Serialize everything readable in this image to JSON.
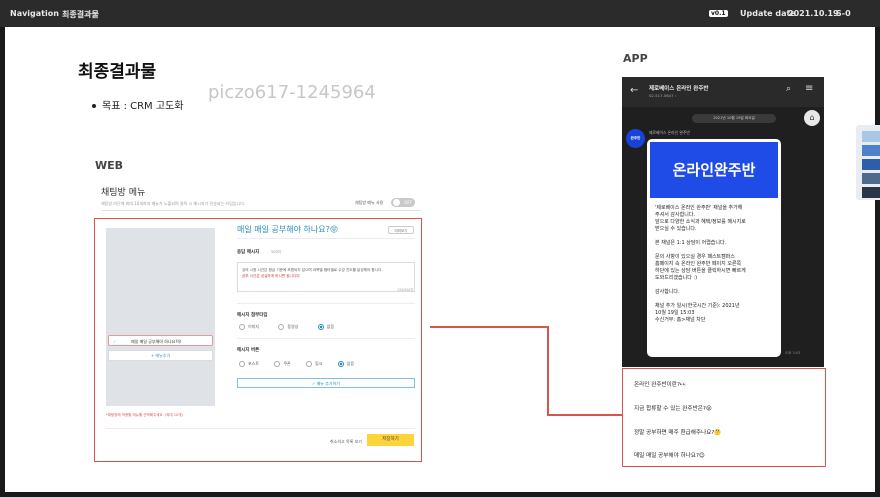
{
  "topbar": {
    "nav": "Navigation",
    "page": "최종결과물",
    "version": "v0.1",
    "update_label": "Update date",
    "update_date": "2021.10.19",
    "slide_no": "S-0"
  },
  "slide": {
    "title": "최종결과물",
    "goal": "목표 : CRM 고도화",
    "watermark": "piczo617-1245964",
    "web_label": "WEB",
    "app_label": "APP"
  },
  "web": {
    "header_title": "채팅방 메뉴",
    "header_desc": "채팅방 하단에 최대 10개까지 메뉴가 노출되며 클릭 시 메시지가 전송되는 타입입니다.",
    "toggle_label": "채팅방 메뉴 사용",
    "toggle_state": "OFF",
    "chip_text": "매일 매일 공부해야 하나요?😝",
    "add_menu": "+ 메뉴추가",
    "note": "*채팅방에 적용할 메뉴를 선택해주세요. (최대 10개)",
    "form_title": "매일 매일 공부해야 하나요?😝",
    "preview_button": "미리보기",
    "answer_label": "응답 메시지",
    "answer_sub": "500자",
    "answer_text_1": "강의 시청 시간은 환급 기준에 포함되지 않으며 과목별 챕터별로 수강 진도를 달성해야 합니다.",
    "answer_text_2": "공부 시간은 성실하게 하시면 됩니다😊",
    "counter": "134/500자",
    "attach_label": "메시지 첨부타입",
    "attach_options": [
      "이미지",
      "동영상",
      "없음"
    ],
    "button_label": "메시지 버튼",
    "button_options": [
      "포스트",
      "쿠폰",
      "링크",
      "없음"
    ],
    "add_message_btn": "✓ 메뉴 추가하기",
    "cancel": "취소하고 목록 보기",
    "save": "저장하기"
  },
  "app": {
    "channel_name": "제로베이스 온라인 완주반",
    "channel_sub": "02-517-0647 ›",
    "date_pill": "2021년 10월 19일 화요일",
    "sender": "제로베이스 온라인 완주반",
    "avatar_text": "완주반",
    "banner": "온라인완주반",
    "body_lines": [
      "'제로베이스 온라인 완주반' 채널을 추가해",
      "주셔서 감사합니다.",
      "앞으로 다양한 소식과 혜택/정보를 메시지로",
      "받으실 수 있습니다.",
      "",
      "본 채널은 1:1 상담이 어렵습니다.",
      "",
      "문의 사항이 있으실 경우 패스트캠퍼스",
      "홈페이지 속 온라인 완주반 페이지 오른쪽",
      "하단에 있는 상담 버튼을 클릭하시면 빠르게",
      "도와드리겠습니다 :)",
      "",
      "감사합니다.",
      "",
      "채널 추가 일시(한국시간 기준): 2021년",
      "10월 19일 15:03",
      "수신거부: 홈>채널 차단"
    ],
    "time": "오후 3:03",
    "menu_items": [
      "온라인 완주반이란?👀",
      "지금 합류할 수 있는 완주반은?😝",
      "정말 공부하면 매주 환급해주나요?🤔",
      "매일 매일 공부해야 하나요?😊"
    ]
  },
  "colors": {
    "accent_red": "#d9534f",
    "brand_blue": "#1f4be6",
    "save_yellow": "#ffd43b",
    "link_blue": "#2a8fb5"
  },
  "icons": [
    "back-arrow-icon",
    "search-icon",
    "hamburger-menu-icon",
    "home-icon",
    "check-icon"
  ]
}
